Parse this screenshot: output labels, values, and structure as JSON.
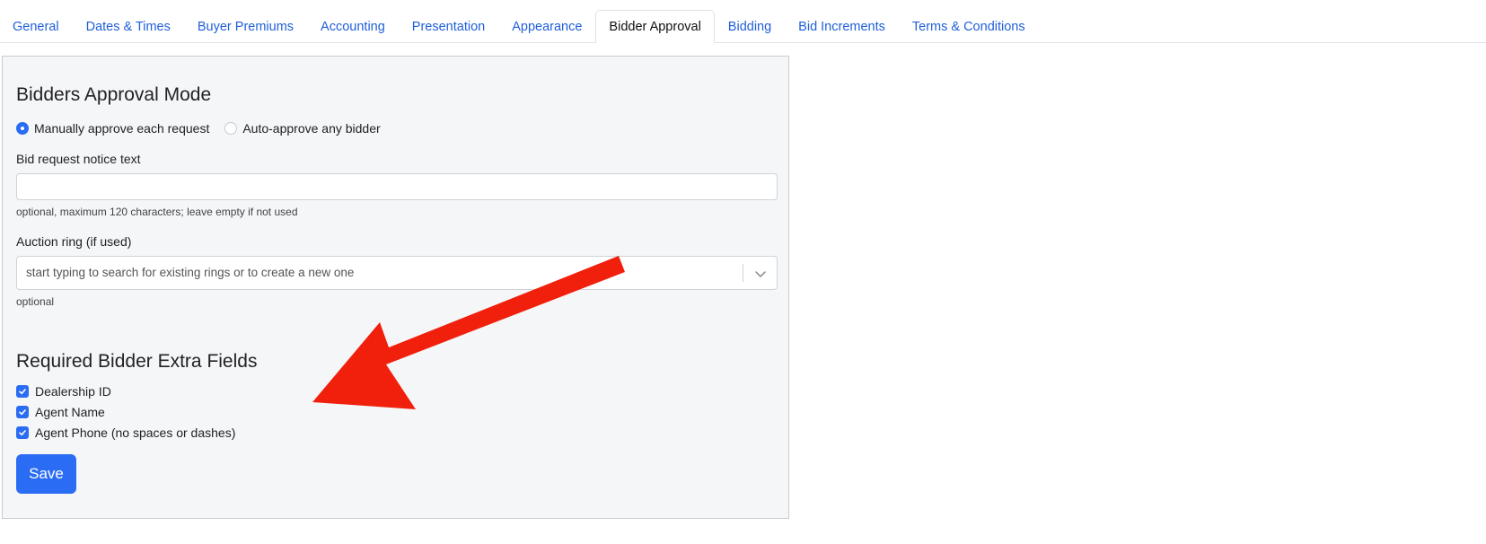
{
  "tabs": [
    {
      "label": "General"
    },
    {
      "label": "Dates & Times"
    },
    {
      "label": "Buyer Premiums"
    },
    {
      "label": "Accounting"
    },
    {
      "label": "Presentation"
    },
    {
      "label": "Appearance"
    },
    {
      "label": "Bidder Approval",
      "active": true
    },
    {
      "label": "Bidding"
    },
    {
      "label": "Bid Increments"
    },
    {
      "label": "Terms & Conditions"
    }
  ],
  "approval": {
    "title": "Bidders Approval Mode",
    "options": [
      {
        "label": "Manually approve each request",
        "selected": true
      },
      {
        "label": "Auto-approve any bidder",
        "selected": false
      }
    ]
  },
  "notice": {
    "label": "Bid request notice text",
    "value": "",
    "help": "optional, maximum 120 characters; leave empty if not used"
  },
  "ring": {
    "label": "Auction ring (if used)",
    "placeholder": "start typing to search for existing rings or to create a new one",
    "help": "optional",
    "icon": "chevron-down-icon"
  },
  "extra_fields": {
    "title": "Required Bidder Extra Fields",
    "items": [
      {
        "label": "Dealership ID",
        "checked": true
      },
      {
        "label": "Agent Name",
        "checked": true
      },
      {
        "label": "Agent Phone (no spaces or dashes)",
        "checked": true
      }
    ]
  },
  "save_label": "Save",
  "colors": {
    "accent": "#2a6df4",
    "link": "#1f5fdb",
    "annotation_arrow": "#f0200c",
    "panel_bg": "#f5f6f8"
  }
}
